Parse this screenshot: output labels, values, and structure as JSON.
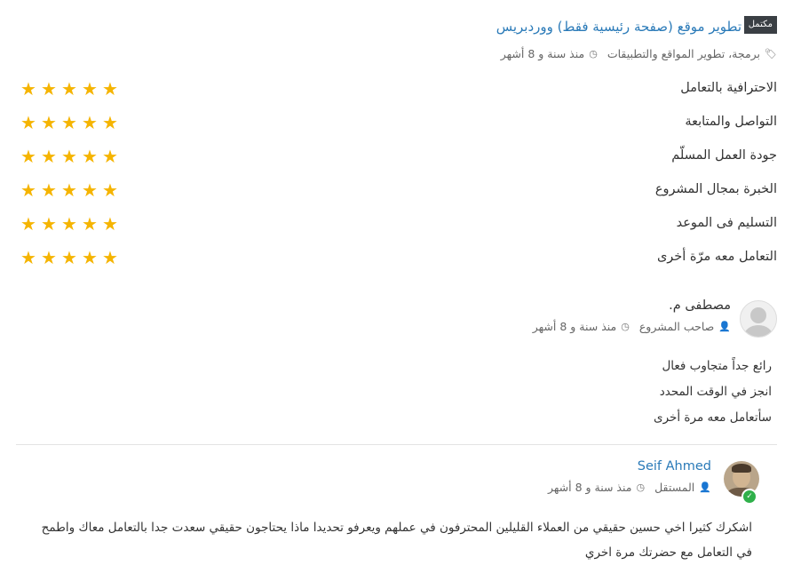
{
  "project": {
    "status_badge": "مكتمل",
    "title": "تطوير موقع (صفحة رئيسية فقط) ووردبريس",
    "tags": "برمجة، تطوير المواقع والتطبيقات",
    "time": "منذ سنة و 8 أشهر",
    "icons": {
      "tag": "tag-icon",
      "clock": "clock-icon"
    }
  },
  "ratings": [
    {
      "label": "الاحترافية بالتعامل",
      "stars": 5
    },
    {
      "label": "التواصل والمتابعة",
      "stars": 5
    },
    {
      "label": "جودة العمل المسلّم",
      "stars": 5
    },
    {
      "label": "الخبرة بمجال المشروع",
      "stars": 5
    },
    {
      "label": "التسليم فى الموعد",
      "stars": 5
    },
    {
      "label": "التعامل معه مرّة أخرى",
      "stars": 5
    }
  ],
  "review": {
    "author": "مصطفى م.",
    "role": "صاحب المشروع",
    "time": "منذ سنة و 8 أشهر",
    "lines": [
      "رائع جداً متجاوب فعال",
      "انجز في الوقت المحدد",
      "سأتعامل معه مرة أخرى"
    ]
  },
  "reply": {
    "author": "Seif Ahmed",
    "role": "المستقل",
    "time": "منذ سنة و 8 أشهر",
    "text": "اشكرك كثيرا اخي حسين حقيقي من العملاء القليلين المحترفون في عملهم ويعرفو تحديدا ماذا يحتاجون حقيقي سعدت جدا بالتعامل معاك واطمح في التعامل مع حضرتك مرة اخري"
  },
  "colors": {
    "star": "#f5b400",
    "link": "#2a7ab8",
    "badge": "#3a3f44",
    "verified": "#2fb04a"
  }
}
